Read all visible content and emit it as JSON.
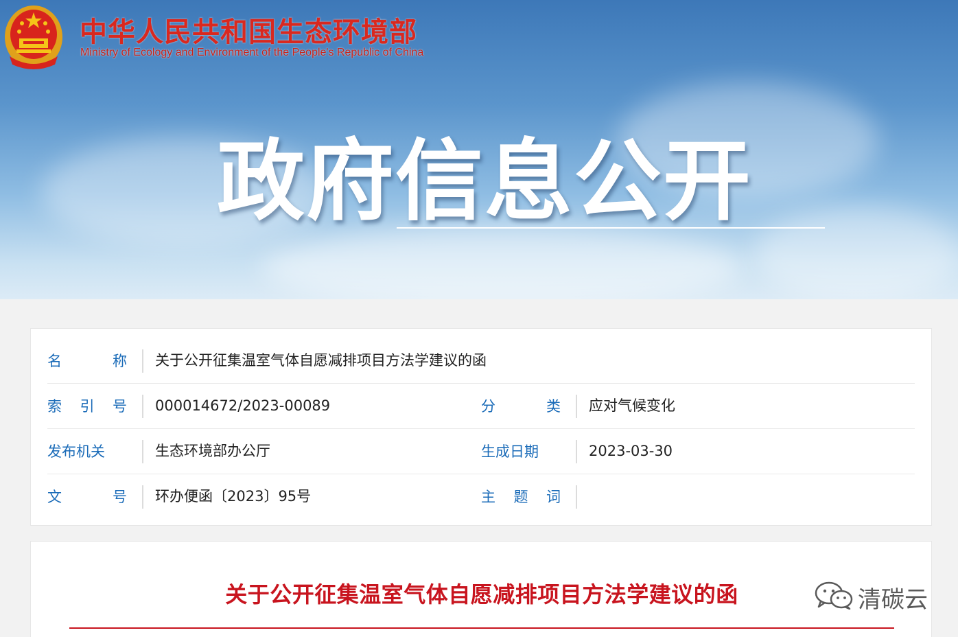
{
  "header": {
    "ministry_name_cn": "中华人民共和国生态环境部",
    "ministry_name_en": "Ministry of Ecology and Environment of the People's Republic of China",
    "banner_title": "政府信息公开"
  },
  "metadata": {
    "name_label": [
      "名",
      "称"
    ],
    "name_value": "关于公开征集温室气体自愿减排项目方法学建议的函",
    "index_label": [
      "索",
      "引",
      "号"
    ],
    "index_value": "000014672/2023-00089",
    "category_label": [
      "分",
      "类"
    ],
    "category_value": "应对气候变化",
    "issuer_label": "发布机关",
    "issuer_value": "生态环境部办公厅",
    "date_label": "生成日期",
    "date_value": "2023-03-30",
    "docno_label": [
      "文",
      "号"
    ],
    "docno_value": "环办便函〔2023〕95号",
    "keywords_label": [
      "主",
      "题",
      "词"
    ],
    "keywords_value": ""
  },
  "article": {
    "title": "关于公开征集温室气体自愿减排项目方法学建议的函"
  },
  "watermark": {
    "text": "清碳云"
  },
  "colors": {
    "label_blue": "#1a6bb8",
    "title_red": "#c8141e",
    "ministry_red": "#d9281f"
  }
}
